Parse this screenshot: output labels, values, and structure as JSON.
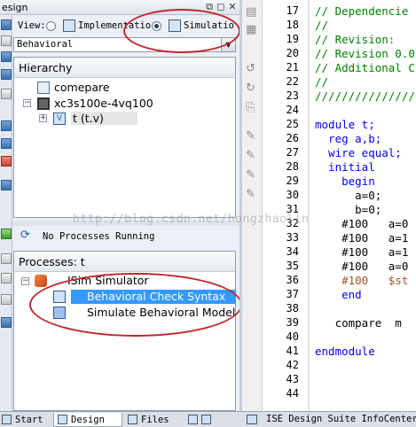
{
  "design_panel": {
    "title": "esign",
    "view": {
      "label": "View:",
      "option_implementation": "Implementatio",
      "option_simulation": "Simulatio",
      "selected": "Simulation"
    },
    "dropdown_value": "Behavioral",
    "hierarchy": {
      "header": "Hierarchy",
      "items": [
        {
          "label": "comepare",
          "icon": "file-icon"
        },
        {
          "label": "xc3s100e-4vq100",
          "icon": "chip-icon"
        },
        {
          "label": "t (t.v)",
          "icon": "verilog-icon"
        }
      ]
    },
    "processes": {
      "status": "No Processes Running",
      "header": "Processes: t",
      "items": [
        {
          "label": "ISim Simulator",
          "icon": "isim-icon"
        },
        {
          "label": "Behavioral Check Syntax",
          "icon": "check-syntax-icon",
          "selected": true
        },
        {
          "label": "Simulate Behavioral Model",
          "icon": "simulate-icon"
        }
      ]
    },
    "tabs": [
      "Start",
      "Design",
      "Files",
      ""
    ],
    "active_tab": "Design"
  },
  "editor": {
    "line_numbers": [
      "17",
      "18",
      "19",
      "20",
      "21",
      "22",
      "23",
      "24",
      "25",
      "26",
      "27",
      "28",
      "29",
      "30",
      "31",
      "32",
      "33",
      "34",
      "35",
      "36",
      "37",
      "38",
      "39",
      "40",
      "41",
      "42",
      "43",
      "44"
    ],
    "lines": [
      "// Dependencie",
      "//",
      "// Revision:",
      "// Revision 0.0",
      "// Additional C",
      "//",
      "///////////////",
      "",
      "module t;",
      "  reg a,b;",
      "  wire equal;",
      "  initial",
      "    begin",
      "      a=0;",
      "      b=0;",
      "    #100   a=0",
      "    #100   a=1",
      "    #100   a=1",
      "    #100   a=0",
      "    #100   $st",
      "    end",
      "",
      "   compare  m",
      "",
      "endmodule",
      "",
      "",
      ""
    ],
    "status_tab": "ISE Design Suite InfoCenter"
  },
  "watermark": "http://blog.csdn.net/hongzhaolin",
  "colors": {
    "comment": "#008000",
    "keyword": "#0000ff",
    "selection": "#3399ff",
    "annotation_circle": "#c0272d"
  }
}
